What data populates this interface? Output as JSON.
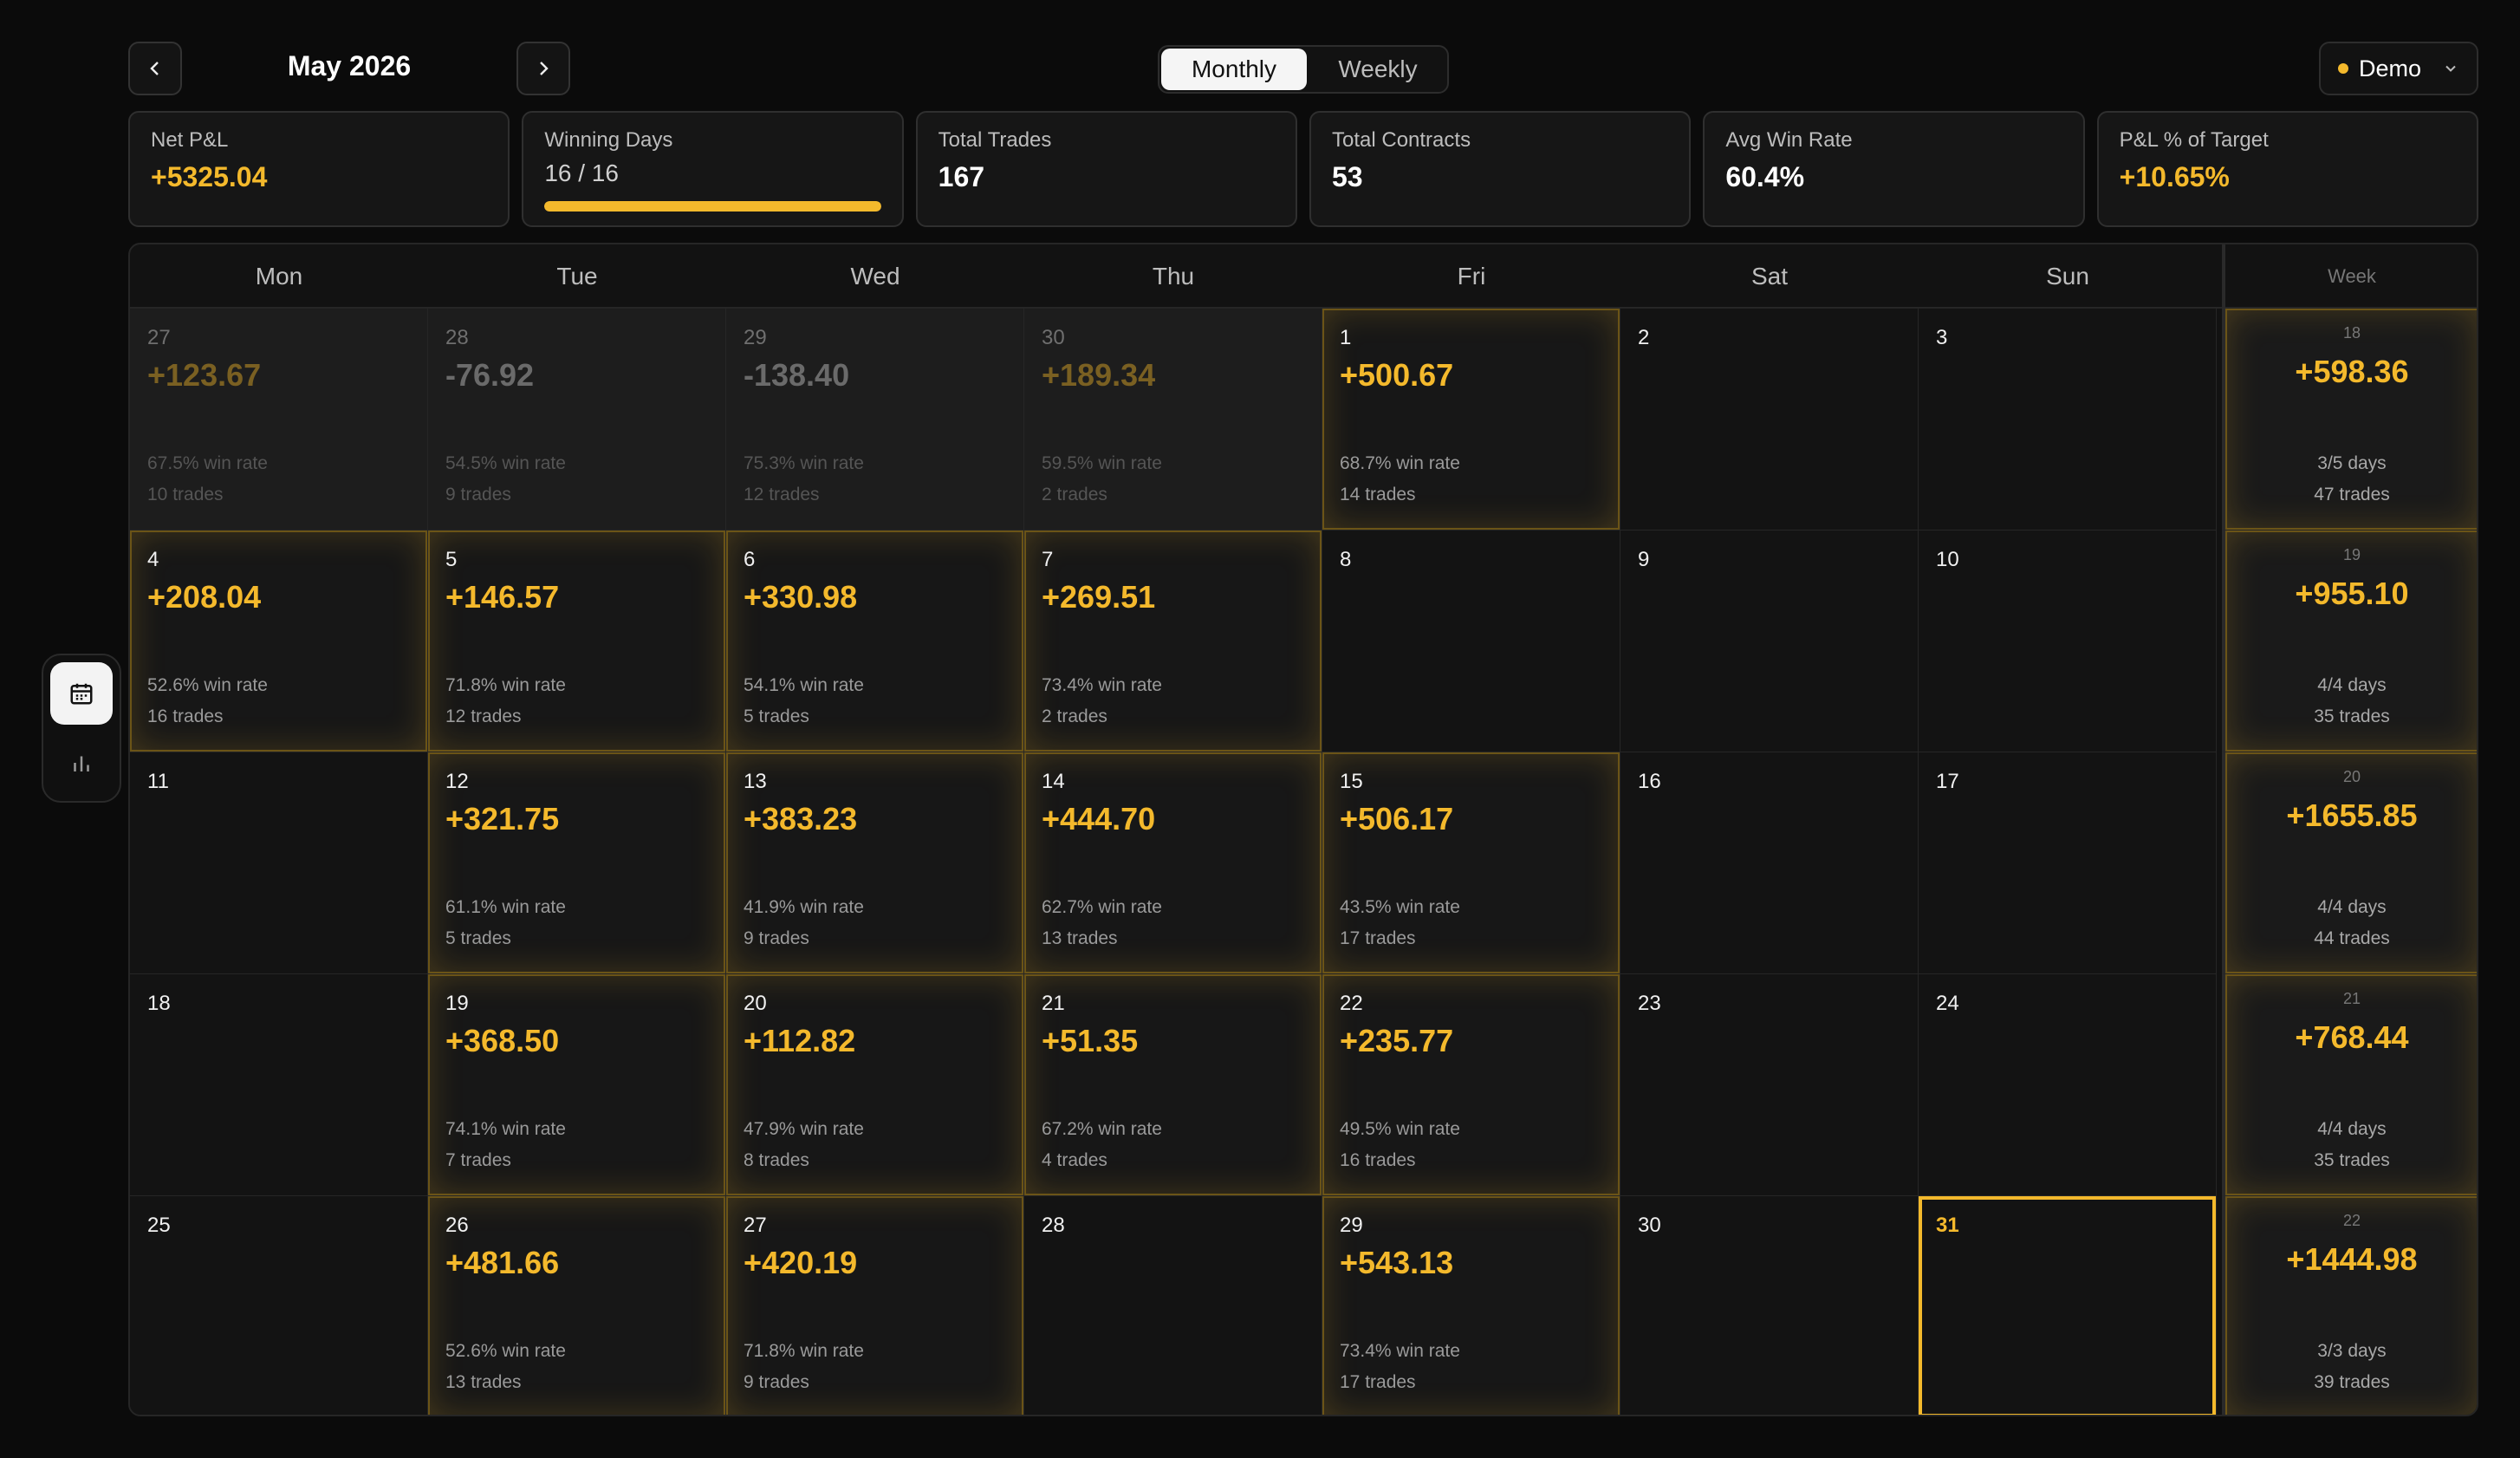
{
  "header": {
    "month_title": "May 2026",
    "prev_icon": "chevron-left-icon",
    "next_icon": "chevron-right-icon",
    "view_tabs": [
      {
        "label": "Monthly",
        "active": true
      },
      {
        "label": "Weekly",
        "active": false
      }
    ],
    "account": {
      "label": "Demo",
      "status_color": "#f4b92c",
      "icon": "chevron-down-icon"
    }
  },
  "rail": {
    "items": [
      {
        "icon": "calendar-icon",
        "active": true
      },
      {
        "icon": "bar-chart-icon",
        "active": false
      }
    ]
  },
  "stats": [
    {
      "label": "Net P&L",
      "value": "+5325.04",
      "accent": true
    },
    {
      "label": "Winning Days",
      "value": "16 / 16",
      "progress": 1.0
    },
    {
      "label": "Total Trades",
      "value": "167"
    },
    {
      "label": "Total Contracts",
      "value": "53"
    },
    {
      "label": "Avg Win Rate",
      "value": "60.4%"
    },
    {
      "label": "P&L % of Target",
      "value": "+10.65%",
      "accent": true
    }
  ],
  "calendar": {
    "weekdays": [
      "Mon",
      "Tue",
      "Wed",
      "Thu",
      "Fri",
      "Sat",
      "Sun"
    ],
    "week_header": "Week",
    "accent": "#f4b92c",
    "weeks": [
      {
        "days": [
          {
            "day": "27",
            "prev": true,
            "pnl": "+123.67",
            "win_rate": "67.5% win rate",
            "trades": "10 trades"
          },
          {
            "day": "28",
            "prev": true,
            "pnl": "-76.92",
            "win_rate": "54.5% win rate",
            "trades": "9 trades"
          },
          {
            "day": "29",
            "prev": true,
            "pnl": "-138.40",
            "win_rate": "75.3% win rate",
            "trades": "12 trades"
          },
          {
            "day": "30",
            "prev": true,
            "pnl": "+189.34",
            "win_rate": "59.5% win rate",
            "trades": "2 trades"
          },
          {
            "day": "1",
            "pnl": "+500.67",
            "win_rate": "68.7% win rate",
            "trades": "14 trades"
          },
          {
            "day": "2"
          },
          {
            "day": "3"
          }
        ],
        "summary": {
          "week": "18",
          "pnl": "+598.36",
          "days": "3/5 days",
          "trades": "47 trades"
        }
      },
      {
        "days": [
          {
            "day": "4",
            "pnl": "+208.04",
            "win_rate": "52.6% win rate",
            "trades": "16 trades"
          },
          {
            "day": "5",
            "pnl": "+146.57",
            "win_rate": "71.8% win rate",
            "trades": "12 trades"
          },
          {
            "day": "6",
            "pnl": "+330.98",
            "win_rate": "54.1% win rate",
            "trades": "5 trades"
          },
          {
            "day": "7",
            "pnl": "+269.51",
            "win_rate": "73.4% win rate",
            "trades": "2 trades"
          },
          {
            "day": "8"
          },
          {
            "day": "9"
          },
          {
            "day": "10"
          }
        ],
        "summary": {
          "week": "19",
          "pnl": "+955.10",
          "days": "4/4 days",
          "trades": "35 trades"
        }
      },
      {
        "days": [
          {
            "day": "11"
          },
          {
            "day": "12",
            "pnl": "+321.75",
            "win_rate": "61.1% win rate",
            "trades": "5 trades"
          },
          {
            "day": "13",
            "pnl": "+383.23",
            "win_rate": "41.9% win rate",
            "trades": "9 trades"
          },
          {
            "day": "14",
            "pnl": "+444.70",
            "win_rate": "62.7% win rate",
            "trades": "13 trades"
          },
          {
            "day": "15",
            "pnl": "+506.17",
            "win_rate": "43.5% win rate",
            "trades": "17 trades"
          },
          {
            "day": "16"
          },
          {
            "day": "17"
          }
        ],
        "summary": {
          "week": "20",
          "pnl": "+1655.85",
          "days": "4/4 days",
          "trades": "44 trades"
        }
      },
      {
        "days": [
          {
            "day": "18"
          },
          {
            "day": "19",
            "pnl": "+368.50",
            "win_rate": "74.1% win rate",
            "trades": "7 trades"
          },
          {
            "day": "20",
            "pnl": "+112.82",
            "win_rate": "47.9% win rate",
            "trades": "8 trades"
          },
          {
            "day": "21",
            "pnl": "+51.35",
            "win_rate": "67.2% win rate",
            "trades": "4 trades"
          },
          {
            "day": "22",
            "pnl": "+235.77",
            "win_rate": "49.5% win rate",
            "trades": "16 trades"
          },
          {
            "day": "23"
          },
          {
            "day": "24"
          }
        ],
        "summary": {
          "week": "21",
          "pnl": "+768.44",
          "days": "4/4 days",
          "trades": "35 trades"
        }
      },
      {
        "days": [
          {
            "day": "25"
          },
          {
            "day": "26",
            "pnl": "+481.66",
            "win_rate": "52.6% win rate",
            "trades": "13 trades"
          },
          {
            "day": "27",
            "pnl": "+420.19",
            "win_rate": "71.8% win rate",
            "trades": "9 trades"
          },
          {
            "day": "28"
          },
          {
            "day": "29",
            "pnl": "+543.13",
            "win_rate": "73.4% win rate",
            "trades": "17 trades"
          },
          {
            "day": "30"
          },
          {
            "day": "31",
            "today": true
          }
        ],
        "summary": {
          "week": "22",
          "pnl": "+1444.98",
          "days": "3/3 days",
          "trades": "39 trades"
        }
      }
    ]
  }
}
